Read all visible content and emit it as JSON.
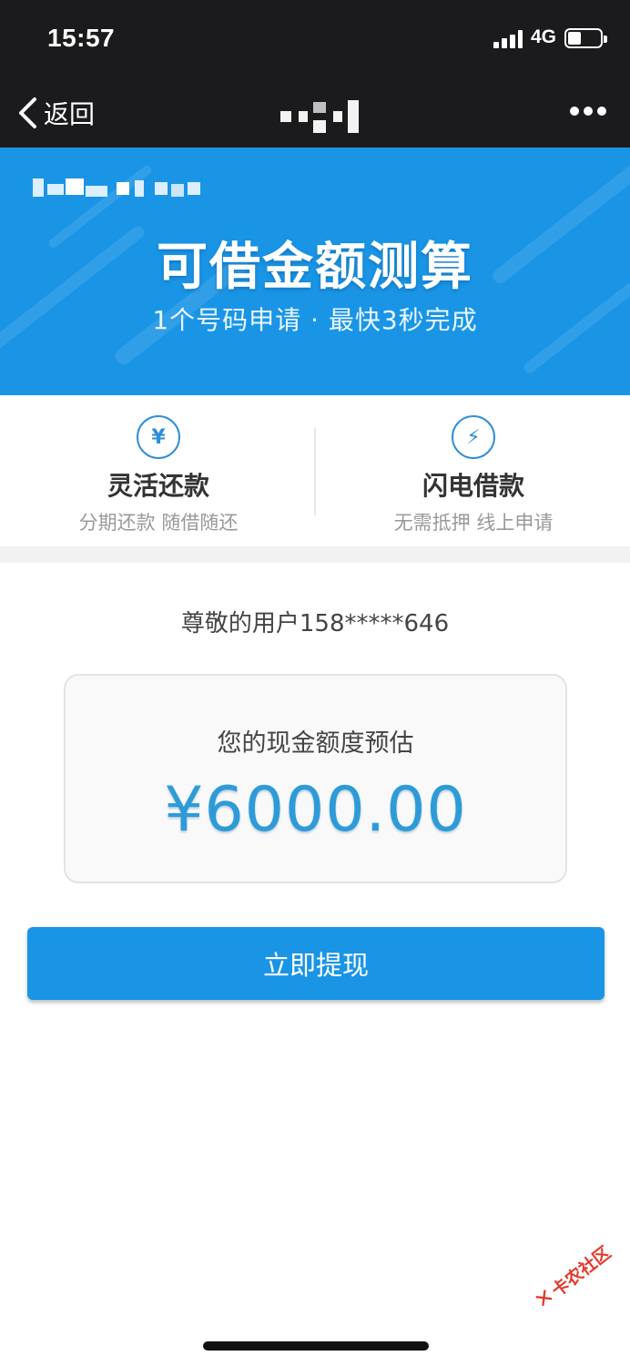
{
  "status_bar": {
    "time": "15:57",
    "network": "4G"
  },
  "nav": {
    "back_label": "返回"
  },
  "hero": {
    "title": "可借金额测算",
    "subtitle": "1个号码申请 · 最快3秒完成"
  },
  "features": [
    {
      "icon": "yuan-cycle-icon",
      "glyph": "¥",
      "title": "灵活还款",
      "subtitle": "分期还款 随借随还"
    },
    {
      "icon": "lightning-icon",
      "glyph": "⚡",
      "title": "闪电借款",
      "subtitle": "无需抵押 线上申请"
    }
  ],
  "greeting": "尊敬的用户158*****646",
  "quota": {
    "label": "您的现金额度预估",
    "amount": "¥6000.00"
  },
  "action": {
    "withdraw_label": "立即提现"
  },
  "watermark": {
    "text": "卡农社区"
  },
  "colors": {
    "primary_blue": "#1a95e6",
    "amount_blue": "#2e9bd8",
    "status_dark": "#1b1b1d"
  }
}
